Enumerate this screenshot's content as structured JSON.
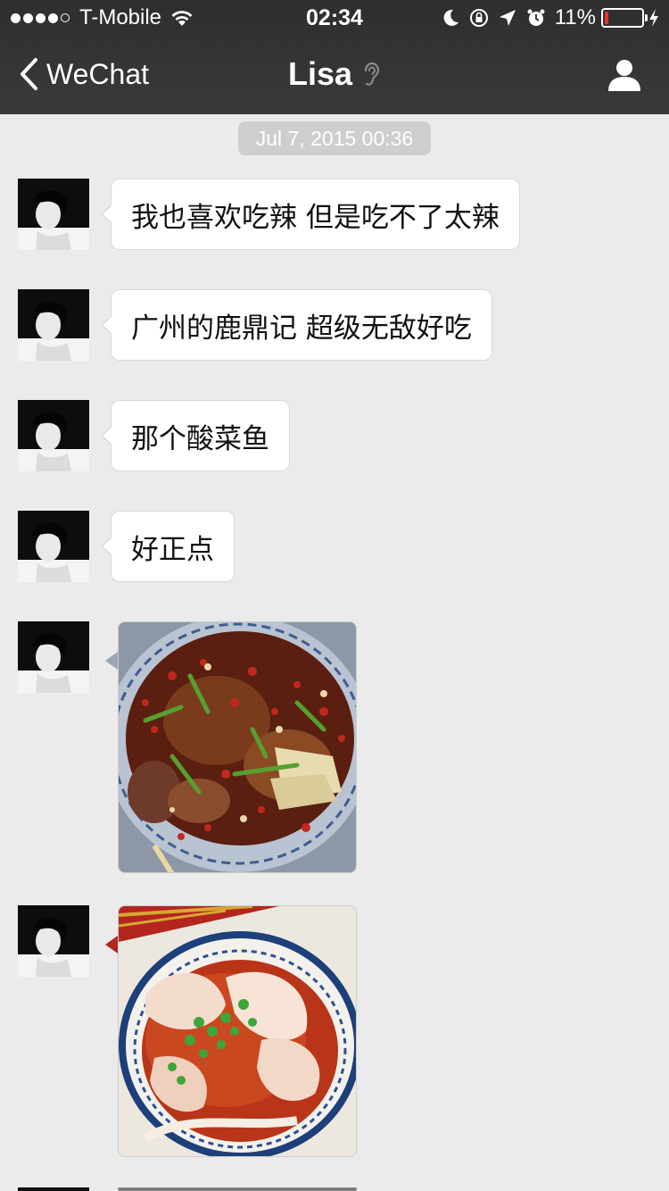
{
  "status_bar": {
    "carrier": "T-Mobile",
    "time": "02:34",
    "battery_percent": "11%",
    "battery_level": 0.11,
    "icons": [
      "signal-dots-icon",
      "wifi-icon",
      "moon-icon",
      "rotation-lock-icon",
      "location-arrow-icon",
      "alarm-icon",
      "battery-icon",
      "charging-bolt-icon"
    ]
  },
  "nav": {
    "back_label": "WeChat",
    "title": "Lisa",
    "icons": [
      "back-chevron-icon",
      "earpiece-icon",
      "profile-icon"
    ]
  },
  "chat": {
    "timestamp": "Jul 7, 2015 00:36",
    "messages": [
      {
        "type": "text",
        "text": "我也喜欢吃辣 但是吃不了太辣"
      },
      {
        "type": "text",
        "text": "广州的鹿鼎记 超级无敌好吃"
      },
      {
        "type": "text",
        "text": "那个酸菜鱼"
      },
      {
        "type": "text",
        "text": "好正点"
      },
      {
        "type": "image",
        "image": "spicy-fish-dish-photo"
      },
      {
        "type": "image",
        "image": "wonton-soup-photo"
      }
    ]
  },
  "colors": {
    "header": "#343536",
    "chat_background": "#ebebeb",
    "bubble": "#ffffff",
    "battery_low": "#e8312e"
  }
}
